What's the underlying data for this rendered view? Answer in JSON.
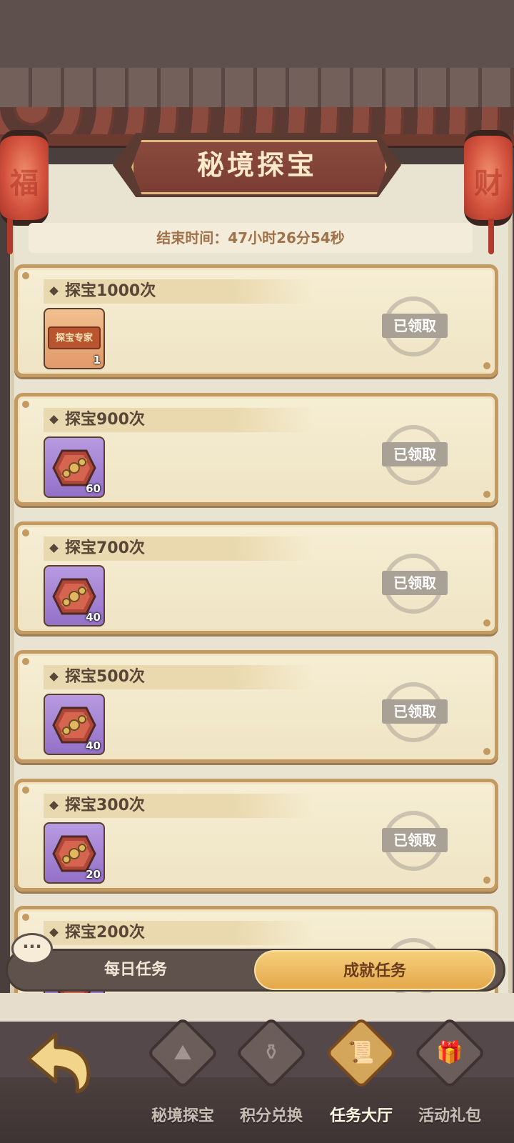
{
  "header": {
    "title": "秘境探宝",
    "timer_text": "结束时间：47小时26分54秒",
    "lantern_left_char": "福",
    "lantern_right_char": "财"
  },
  "tasks": [
    {
      "title": "探宝1000次",
      "reward_type": "banner",
      "reward_label": "探宝专家",
      "count": "1",
      "status": "已领取"
    },
    {
      "title": "探宝900次",
      "reward_type": "chest",
      "count": "60",
      "status": "已领取"
    },
    {
      "title": "探宝700次",
      "reward_type": "chest",
      "count": "40",
      "status": "已领取"
    },
    {
      "title": "探宝500次",
      "reward_type": "chest",
      "count": "40",
      "status": "已领取"
    },
    {
      "title": "探宝300次",
      "reward_type": "chest",
      "count": "20",
      "status": "已领取"
    },
    {
      "title": "探宝200次",
      "reward_type": "chest",
      "count": "",
      "status": ""
    }
  ],
  "tabs": {
    "daily": "每日任务",
    "achievement": "成就任务",
    "selected": "achievement"
  },
  "nav": [
    {
      "label": "秘境探宝",
      "icon": "mountain-icon"
    },
    {
      "label": "积分兑换",
      "icon": "shop-icon"
    },
    {
      "label": "任务大厅",
      "icon": "scroll-icon",
      "active": true
    },
    {
      "label": "活动礼包",
      "icon": "gift-bag-icon"
    }
  ],
  "colors": {
    "card_border": "#c49a63",
    "tab_active": "#e4a84a",
    "claimed_stamp": "#a9a096"
  }
}
